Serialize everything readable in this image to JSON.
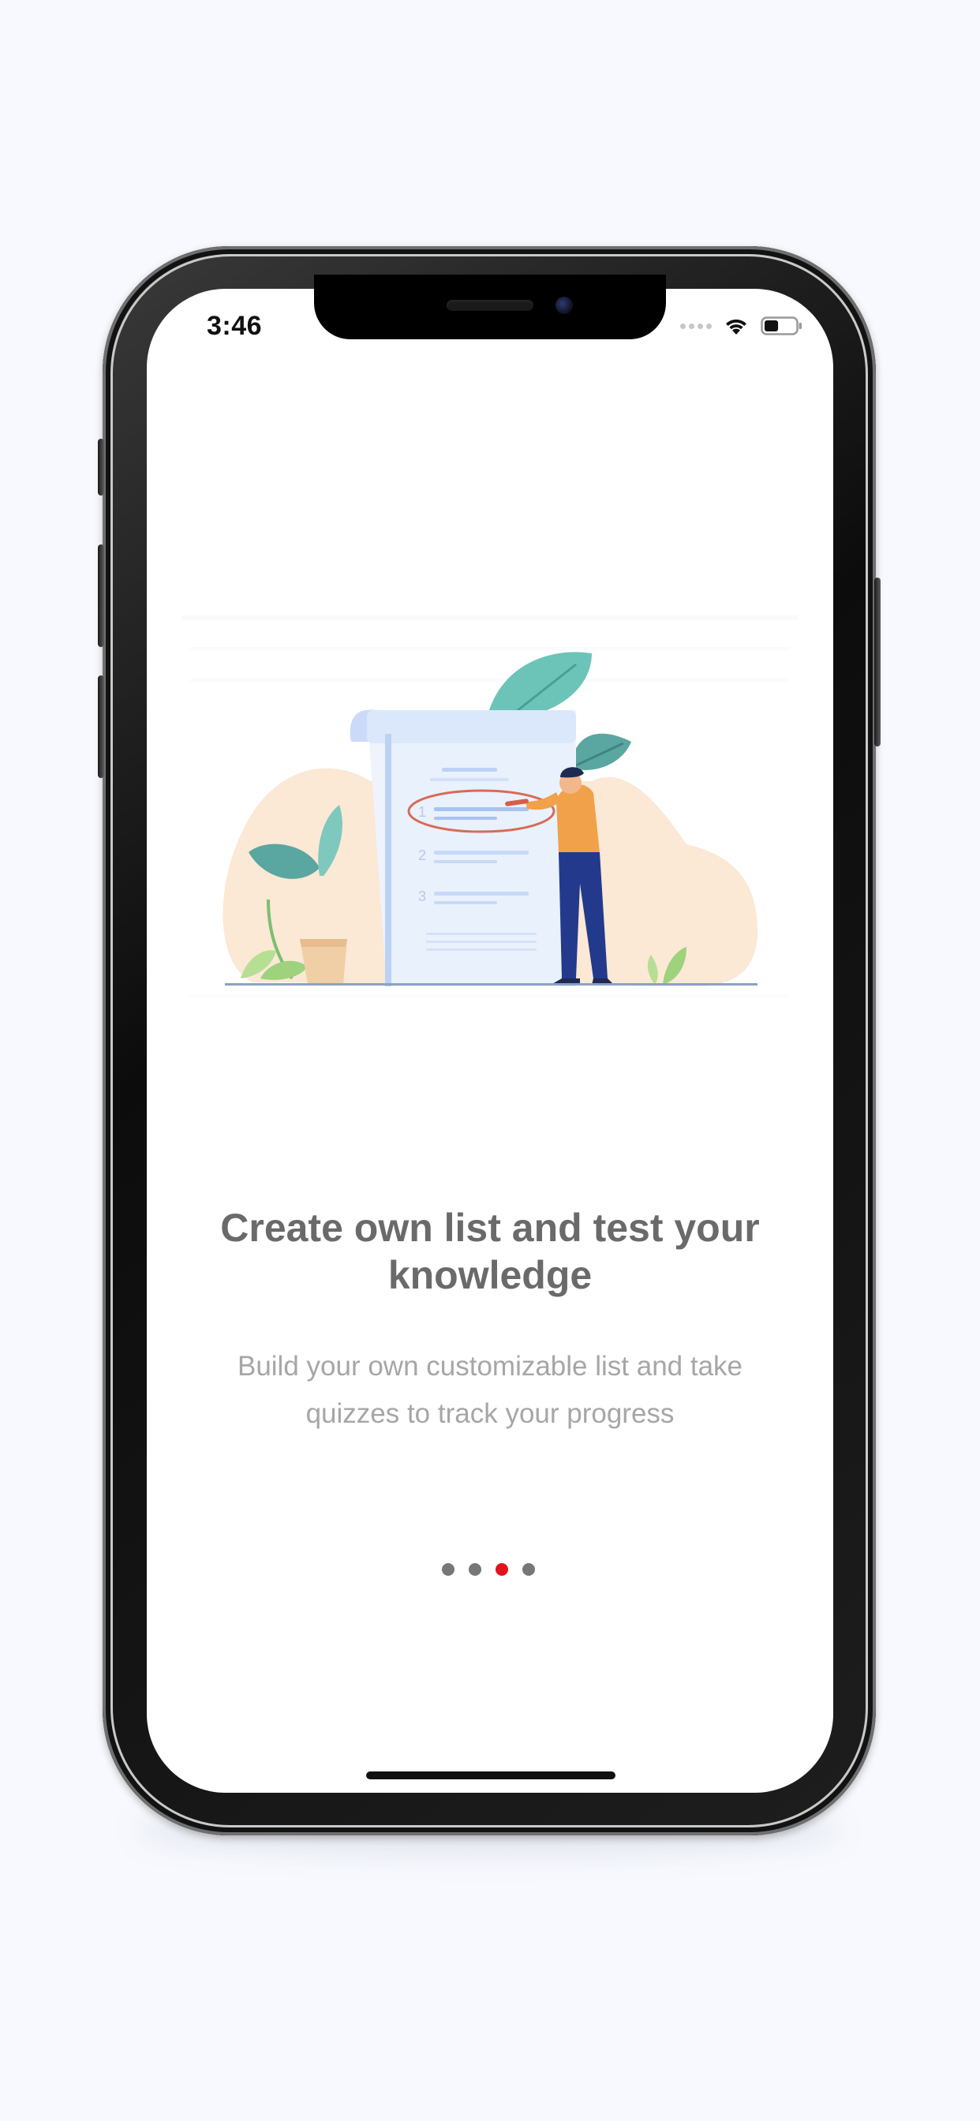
{
  "status_bar": {
    "time": "3:46",
    "signal_icon": "cellular-dots-icon",
    "wifi_icon": "wifi-icon",
    "battery_icon": "battery-icon",
    "battery_level": 0.45
  },
  "onboarding": {
    "illustration_icon": "checklist-illustration",
    "title": "Create own list and test your knowledge",
    "subtitle": "Build your own customizable list and take quizzes to track your progress"
  },
  "pager": {
    "total": 4,
    "active_index": 2,
    "active_color": "#e0141e",
    "inactive_color": "#777777"
  },
  "colors": {
    "background": "#f7f9fe",
    "title": "#6a6a6a",
    "subtitle": "#a6a6a6"
  }
}
